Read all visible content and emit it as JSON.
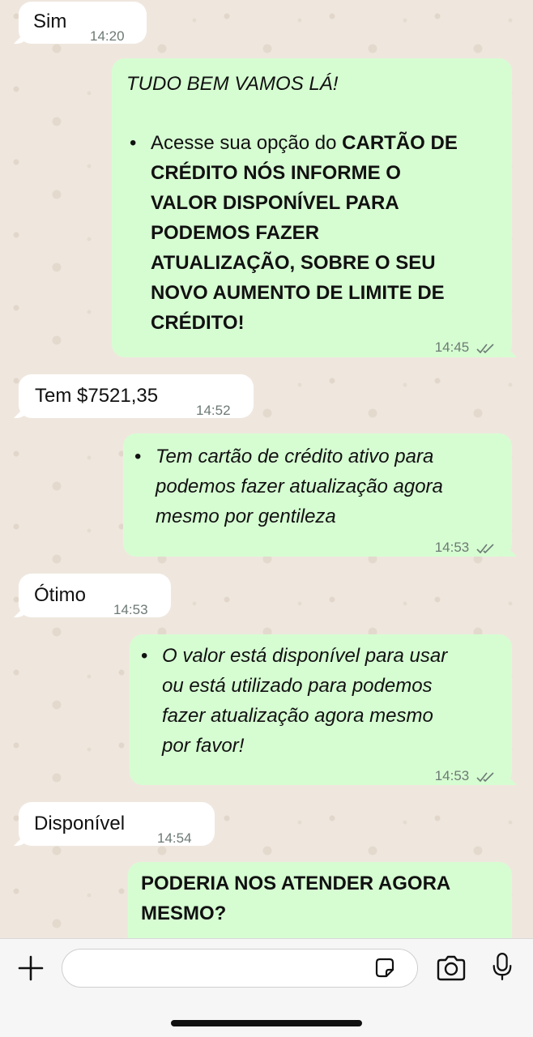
{
  "messages": [
    {
      "id": "m1",
      "direction": "incoming",
      "text": "Sim",
      "time": "14:20"
    },
    {
      "id": "m2",
      "direction": "outgoing",
      "heading": "TUDO BEM VAMOS LÁ!",
      "bullet_plain": "Acesse sua opção do ",
      "bullet_bold_1": "CARTÃO DE",
      "bullet_bold_2": "CRÉDITO NÓS INFORME O",
      "bullet_bold_3": "VALOR DISPONÍVEL PARA",
      "bullet_bold_4": "PODEMOS FAZER",
      "bullet_bold_5": "ATUALIZAÇÃO, SOBRE O SEU",
      "bullet_bold_6": "NOVO AUMENTO DE LIMITE DE",
      "bullet_bold_7": "CRÉDITO!",
      "time": "14:45",
      "status": "read"
    },
    {
      "id": "m3",
      "direction": "incoming",
      "text": "Tem $7521,35",
      "time": "14:52"
    },
    {
      "id": "m4",
      "direction": "outgoing",
      "line_1": "Tem cartão de crédito ativo para",
      "line_2": "podemos fazer atualização agora",
      "line_3": "mesmo por gentileza",
      "time": "14:53",
      "status": "read"
    },
    {
      "id": "m5",
      "direction": "incoming",
      "text": "Ótimo",
      "time": "14:53"
    },
    {
      "id": "m6",
      "direction": "outgoing",
      "line_1": "O valor está disponível para usar",
      "line_2": "ou está utilizado para podemos",
      "line_3": "fazer atualização agora mesmo",
      "line_4": "por favor!",
      "time": "14:53",
      "status": "read"
    },
    {
      "id": "m7",
      "direction": "incoming",
      "text": "Disponível",
      "time": "14:54"
    },
    {
      "id": "m8",
      "direction": "outgoing",
      "line_1": "PODERIA NOS ATENDER AGORA",
      "line_2": "MESMO?"
    }
  ],
  "bullet_char": "•",
  "composer": {
    "add_icon": "plus-icon",
    "sticker_icon": "sticker-icon",
    "camera_icon": "camera-icon",
    "mic_icon": "microphone-icon",
    "input_value": ""
  },
  "colors": {
    "outgoing_bubble": "#d6fdd2",
    "incoming_bubble": "#ffffff",
    "wallpaper": "#efe7de",
    "read_ticks": "#6d7a74"
  }
}
